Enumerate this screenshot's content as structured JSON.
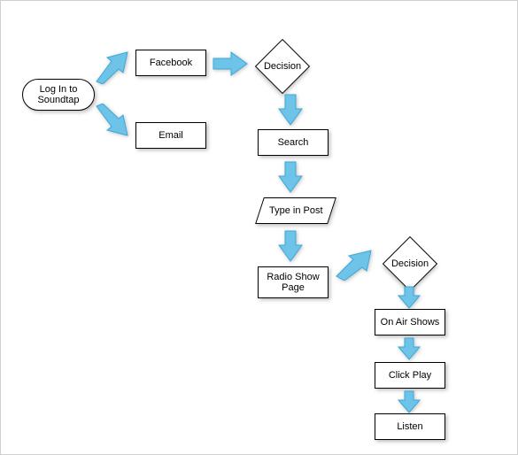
{
  "nodes": {
    "login": "Log In to Soundtap",
    "facebook": "Facebook",
    "email": "Email",
    "decision1": "Decision",
    "search": "Search",
    "type_in_post": "Type in Post",
    "radio_show_page": "Radio Show Page",
    "decision2": "Decision",
    "on_air_shows": "On Air Shows",
    "click_play": "Click Play",
    "listen": "Listen"
  },
  "colors": {
    "arrow_fill": "#6EC3E8",
    "arrow_stroke": "#3DA8D6"
  }
}
